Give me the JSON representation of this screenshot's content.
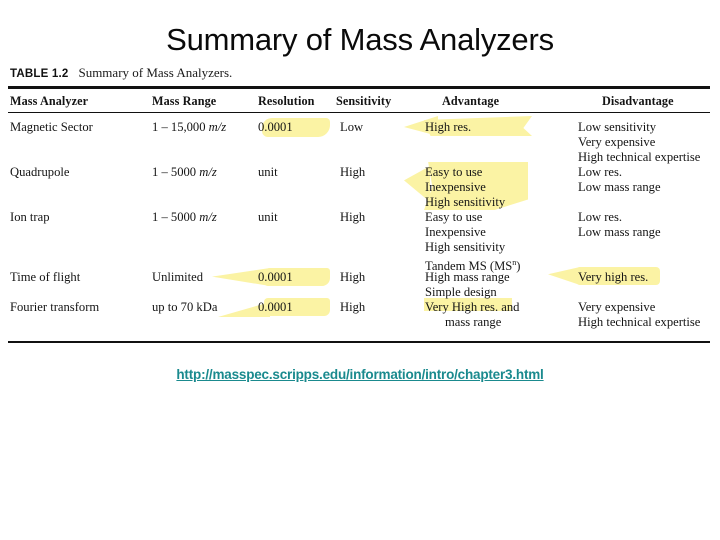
{
  "slide": {
    "title": "Summary of Mass Analyzers",
    "link": "http://masspec.scripps.edu/information/intro/chapter3.html",
    "link_color": "#1a8a8e",
    "highlight_color": "#fbf3a4",
    "background": "#ffffff"
  },
  "figure": {
    "caption_label": "TABLE 1.2",
    "caption_text": "Summary of Mass Analyzers."
  },
  "table": {
    "headers": {
      "analyzer": "Mass Analyzer",
      "range": "Mass Range",
      "resolution": "Resolution",
      "sensitivity": "Sensitivity",
      "advantage": "Advantage",
      "disadvantage": "Disadvantage"
    },
    "rows": [
      {
        "analyzer": "Magnetic Sector",
        "range_value": "1 – 15,000 ",
        "range_unit": "m/z",
        "resolution": "0.0001",
        "sensitivity": "Low",
        "advantage": "High res.",
        "disadvantage": "Low sensitivity\nVery expensive\nHigh technical expertise"
      },
      {
        "analyzer": "Quadrupole",
        "range_value": "1 – 5000 ",
        "range_unit": "m/z",
        "resolution": "unit",
        "sensitivity": "High",
        "advantage": "Easy to use\nInexpensive\nHigh sensitivity",
        "disadvantage": "Low res.\nLow mass range"
      },
      {
        "analyzer": "Ion trap",
        "range_value": "1 – 5000 ",
        "range_unit": "m/z",
        "resolution": "unit",
        "sensitivity": "High",
        "advantage": "Easy to use\nInexpensive\nHigh sensitivity\nTandem MS (MS",
        "advantage_sup": "n",
        "advantage_tail": ")",
        "disadvantage": "Low res.\nLow mass range"
      },
      {
        "analyzer": "Time of flight",
        "range_value": "Unlimited",
        "range_unit": "",
        "resolution": "0.0001",
        "sensitivity": "High",
        "advantage": "High mass range\nSimple design",
        "disadvantage": "Very high res."
      },
      {
        "analyzer": "Fourier transform",
        "range_value": "up to 70 kDa",
        "range_unit": "",
        "resolution": "0.0001",
        "sensitivity": "High",
        "advantage": "Very High res. and",
        "advantage_line2": "mass range",
        "disadvantage": "Very expensive\nHigh technical expertise"
      }
    ]
  }
}
